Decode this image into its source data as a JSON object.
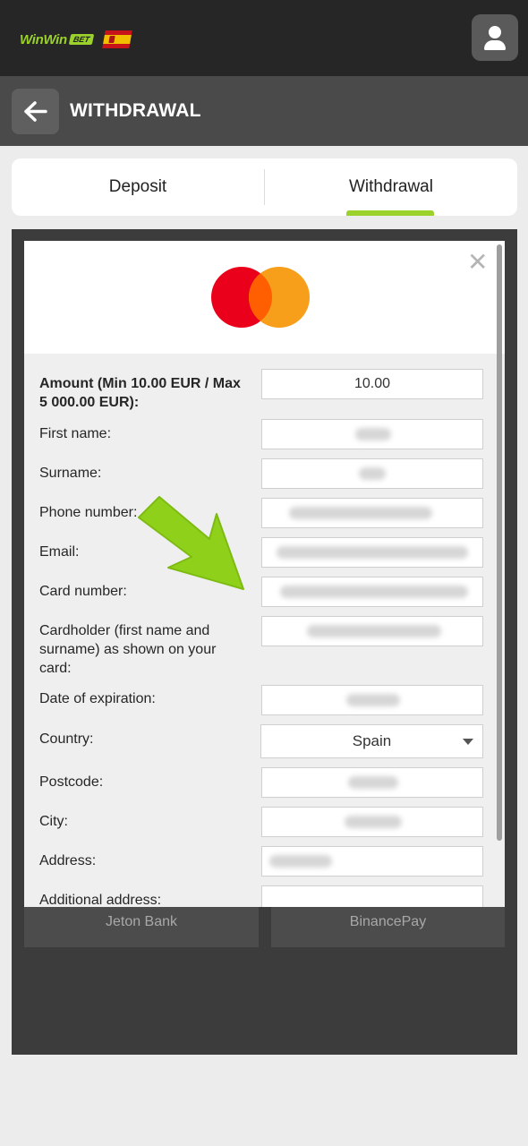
{
  "topbar": {
    "logo_word": "WinWin",
    "logo_badge": "BET",
    "flag": "spain-flag",
    "user_icon": "user-icon"
  },
  "header": {
    "title": "WITHDRAWAL",
    "back_icon": "back-arrow-icon"
  },
  "tabs": [
    {
      "label": "Deposit",
      "active": false
    },
    {
      "label": "Withdrawal",
      "active": true
    }
  ],
  "colors": {
    "accent": "#9ad12b",
    "topbar": "#262626",
    "header": "#4a4a4a",
    "mastercard_red": "#eb001b",
    "mastercard_orange": "#f79e1b"
  },
  "modal": {
    "logo": "mastercard-logo",
    "close_icon": "close-icon",
    "fields": {
      "amount": {
        "label": "Amount (Min 10.00 EUR / Max 5 000.00 EUR):",
        "value": "10.00"
      },
      "first_name": {
        "label": "First name:"
      },
      "surname": {
        "label": "Surname:"
      },
      "phone": {
        "label": "Phone number:"
      },
      "email": {
        "label": "Email:"
      },
      "card_number": {
        "label": "Card number:"
      },
      "cardholder": {
        "label": "Cardholder (first name and surname) as shown on your card:"
      },
      "expiration": {
        "label": "Date of expiration:"
      },
      "country": {
        "label": "Country:",
        "value": "Spain"
      },
      "postcode": {
        "label": "Postcode:"
      },
      "city": {
        "label": "City:"
      },
      "address": {
        "label": "Address:"
      },
      "additional_address": {
        "label": "Additional address:"
      }
    }
  },
  "payment_methods": [
    {
      "label": "Jeton Bank"
    },
    {
      "label": "BinancePay"
    }
  ]
}
